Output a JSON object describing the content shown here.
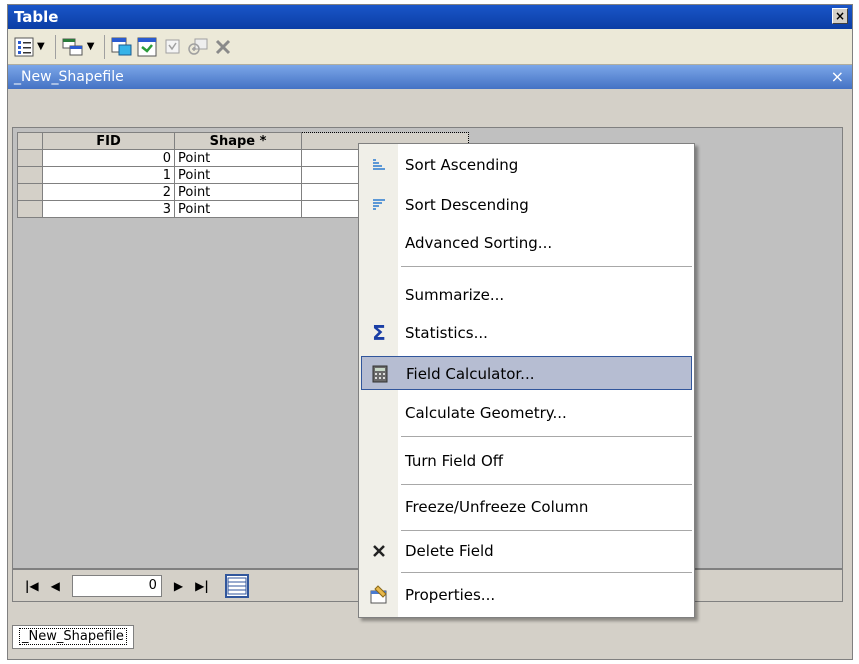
{
  "window": {
    "title": "Table",
    "close_glyph": "×"
  },
  "toolbar": {
    "icons": [
      "table-options-icon",
      "related-tables-icon",
      "select-by-attributes-icon",
      "switch-selection-icon",
      "clear-selection-icon",
      "zoom-to-selected-icon",
      "delete-selected-icon"
    ]
  },
  "panel": {
    "title": "_New_Shapefile",
    "close_glyph": "×"
  },
  "grid": {
    "columns": [
      "FID",
      "Shape *",
      ""
    ],
    "rows": [
      {
        "fid": "0",
        "shape": "Point"
      },
      {
        "fid": "1",
        "shape": "Point"
      },
      {
        "fid": "2",
        "shape": "Point"
      },
      {
        "fid": "3",
        "shape": "Point"
      }
    ]
  },
  "nav": {
    "record_value": "0"
  },
  "tabs": [
    {
      "label": "_New_Shapefile"
    }
  ],
  "context_menu": {
    "items": [
      {
        "label": "Sort Ascending",
        "icon": "sort-ascending-icon"
      },
      {
        "label": "Sort Descending",
        "icon": "sort-descending-icon"
      },
      {
        "label": "Advanced Sorting...",
        "icon": ""
      },
      {
        "label": "Summarize...",
        "icon": ""
      },
      {
        "label": "Statistics...",
        "icon": "sigma-icon"
      },
      {
        "label": "Field Calculator...",
        "icon": "calculator-icon",
        "highlighted": true
      },
      {
        "label": "Calculate Geometry...",
        "icon": ""
      },
      {
        "label": "Turn Field Off",
        "icon": ""
      },
      {
        "label": "Freeze/Unfreeze Column",
        "icon": ""
      },
      {
        "label": "Delete Field",
        "icon": "delete-x-icon"
      },
      {
        "label": "Properties...",
        "icon": "properties-icon"
      }
    ]
  },
  "colors": {
    "titlebar": "#0b3ea5",
    "panelbar": "#4472c4",
    "highlight": "#b6bdd2",
    "highlight_border": "#31569c"
  }
}
